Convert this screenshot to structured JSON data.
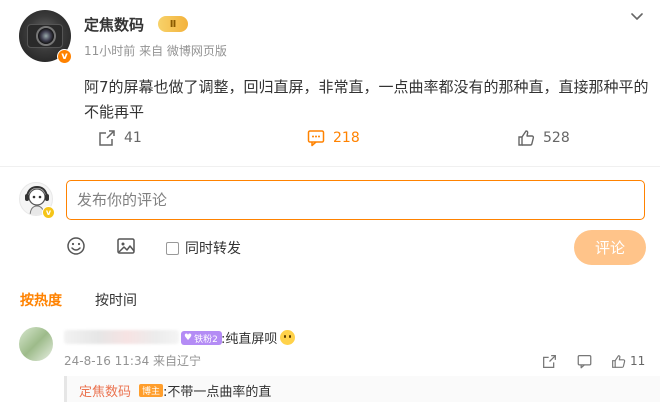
{
  "post": {
    "author": "定焦数码",
    "level_badge": "Ⅱ",
    "meta": "11小时前 来自 微博网页版",
    "text": "阿7的屏幕也做了调整，回归直屏，非常直，一点曲率都没有的那种直，直接那种平的不能再平",
    "actions": {
      "repost_count": "41",
      "comment_count": "218",
      "like_count": "528"
    }
  },
  "composer": {
    "placeholder": "发布你的评论",
    "repost_label": "同时转发",
    "submit_label": "评论"
  },
  "sort_tabs": {
    "hot": "按热度",
    "time": "按时间"
  },
  "comment": {
    "fan_badge": "铁粉2",
    "text": ":纯直屏呗",
    "meta": "24-8-16 11:34 来自辽宁",
    "like_count": "11"
  },
  "reply": {
    "author": "定焦数码",
    "badge": "博主",
    "text": ":不带一点曲率的直"
  },
  "colors": {
    "accent": "#ff8200",
    "submit_disabled": "#ffc48a",
    "muted_text": "#939393",
    "reply_author": "#eb7350"
  }
}
